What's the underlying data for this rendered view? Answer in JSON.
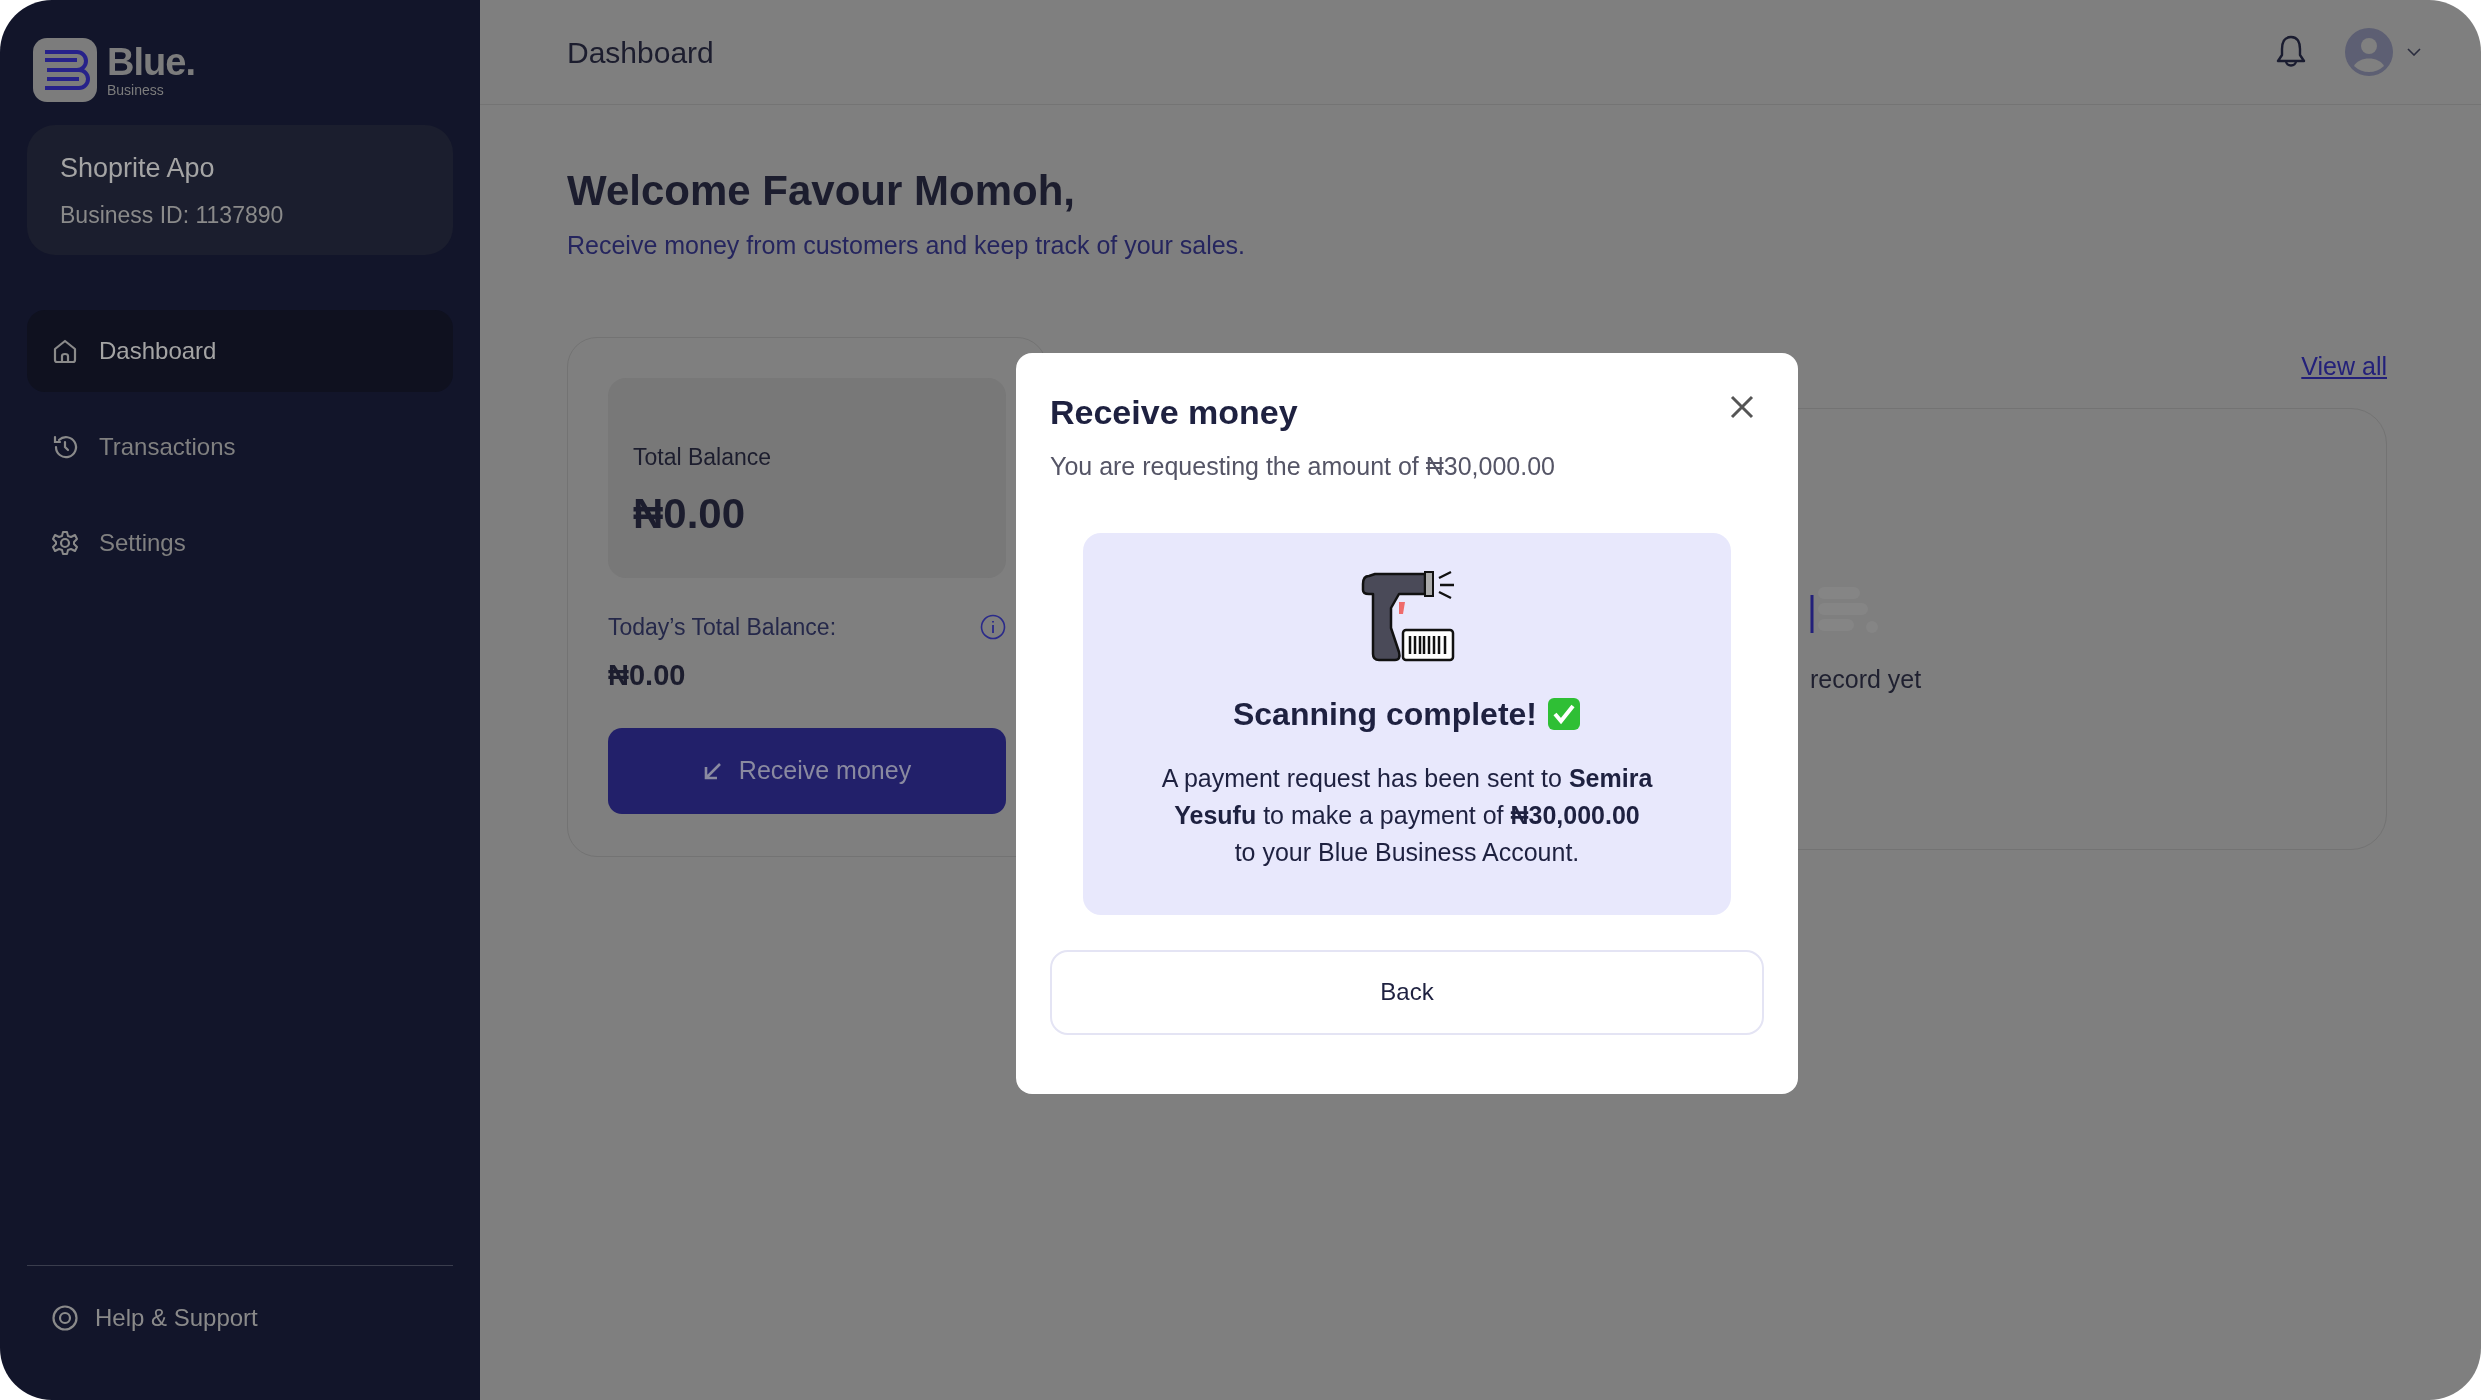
{
  "sidebar": {
    "logo": {
      "name": "Blue.",
      "tagline": "Business"
    },
    "business": {
      "name": "Shoprite Apo",
      "id": "Business ID: 1137890"
    },
    "nav": [
      {
        "label": "Dashboard",
        "selected": true
      },
      {
        "label": "Transactions",
        "selected": false
      },
      {
        "label": "Settings",
        "selected": false
      }
    ],
    "footer": {
      "label": "Help & Support"
    }
  },
  "header": {
    "title": "Dashboard"
  },
  "welcome": {
    "heading": "Welcome Favour Momoh,",
    "subtitle": "Receive money from customers and keep track of your sales."
  },
  "balance_card": {
    "label": "Total Balance",
    "amount": "₦0.00",
    "today_label": "Today’s Total Balance:",
    "today_amount": "₦0.00",
    "button": "Receive money"
  },
  "recent": {
    "link": "View all",
    "empty_text": "record yet"
  },
  "modal": {
    "title": "Receive money",
    "subtitle": "You are requesting the amount of ₦30,000.00",
    "status": "Scanning complete!",
    "message": "A payment request has been sent to **Semira Yesufu** to make a payment of **₦30,000.00** to your Blue Business Account.",
    "button": "Back"
  }
}
